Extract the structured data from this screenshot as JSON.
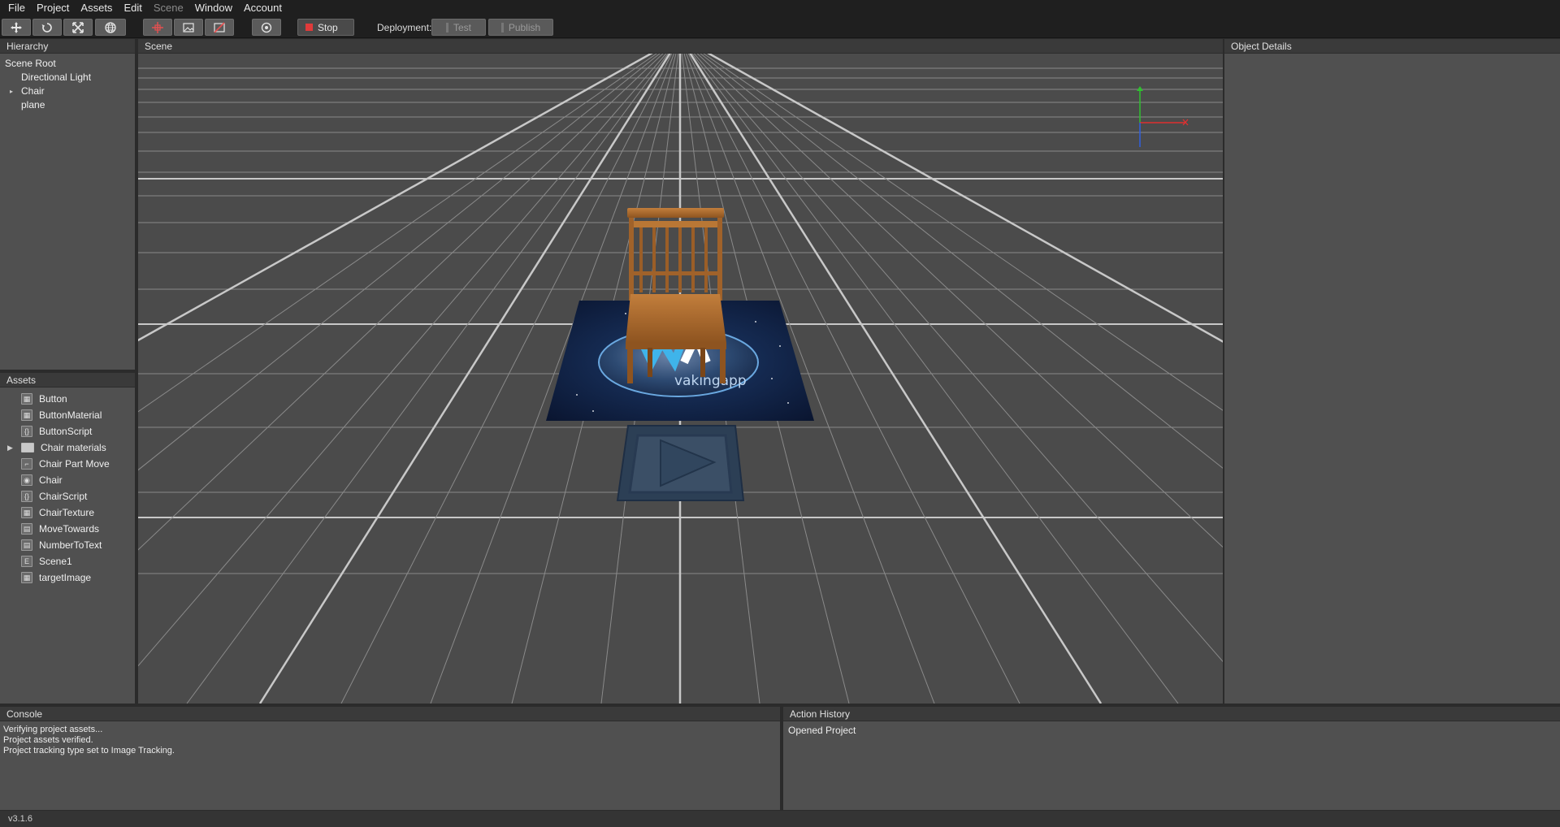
{
  "menu": {
    "items": [
      {
        "label": "File",
        "disabled": false
      },
      {
        "label": "Project",
        "disabled": false
      },
      {
        "label": "Assets",
        "disabled": false
      },
      {
        "label": "Edit",
        "disabled": false
      },
      {
        "label": "Scene",
        "disabled": true
      },
      {
        "label": "Window",
        "disabled": false
      },
      {
        "label": "Account",
        "disabled": false
      }
    ]
  },
  "toolbar": {
    "stop_label": "Stop",
    "deployment_label": "Deployment:",
    "test_label": "Test",
    "publish_label": "Publish"
  },
  "hierarchy": {
    "title": "Hierarchy",
    "root": "Scene Root",
    "children": [
      "Directional Light",
      "Chair",
      "plane"
    ]
  },
  "assets": {
    "title": "Assets",
    "items": [
      {
        "label": "Button",
        "icon": "image-icon"
      },
      {
        "label": "ButtonMaterial",
        "icon": "material-icon"
      },
      {
        "label": "ButtonScript",
        "icon": "script-icon"
      },
      {
        "label": "Chair materials",
        "icon": "folder-icon"
      },
      {
        "label": "Chair Part Move",
        "icon": "animation-icon"
      },
      {
        "label": "Chair",
        "icon": "model-icon"
      },
      {
        "label": "ChairScript",
        "icon": "script-icon"
      },
      {
        "label": "ChairTexture",
        "icon": "image-icon"
      },
      {
        "label": "MoveTowards",
        "icon": "behaviour-icon"
      },
      {
        "label": "NumberToText",
        "icon": "behaviour-icon"
      },
      {
        "label": "Scene1",
        "icon": "scene-icon"
      },
      {
        "label": "targetImage",
        "icon": "image-icon"
      }
    ]
  },
  "scene": {
    "title": "Scene",
    "target_text": "vakingapp"
  },
  "object_details": {
    "title": "Object Details"
  },
  "console": {
    "title": "Console",
    "lines": [
      "Verifying project assets...",
      "Project assets verified.",
      "Project tracking type set to Image Tracking."
    ]
  },
  "action_history": {
    "title": "Action History",
    "lines": [
      "Opened Project"
    ]
  },
  "status": {
    "version": "v3.1.6"
  },
  "colors": {
    "stop": "#e03a3a",
    "gizmo_x": "#e03030",
    "gizmo_y": "#30c030",
    "gizmo_z": "#3060e0"
  }
}
